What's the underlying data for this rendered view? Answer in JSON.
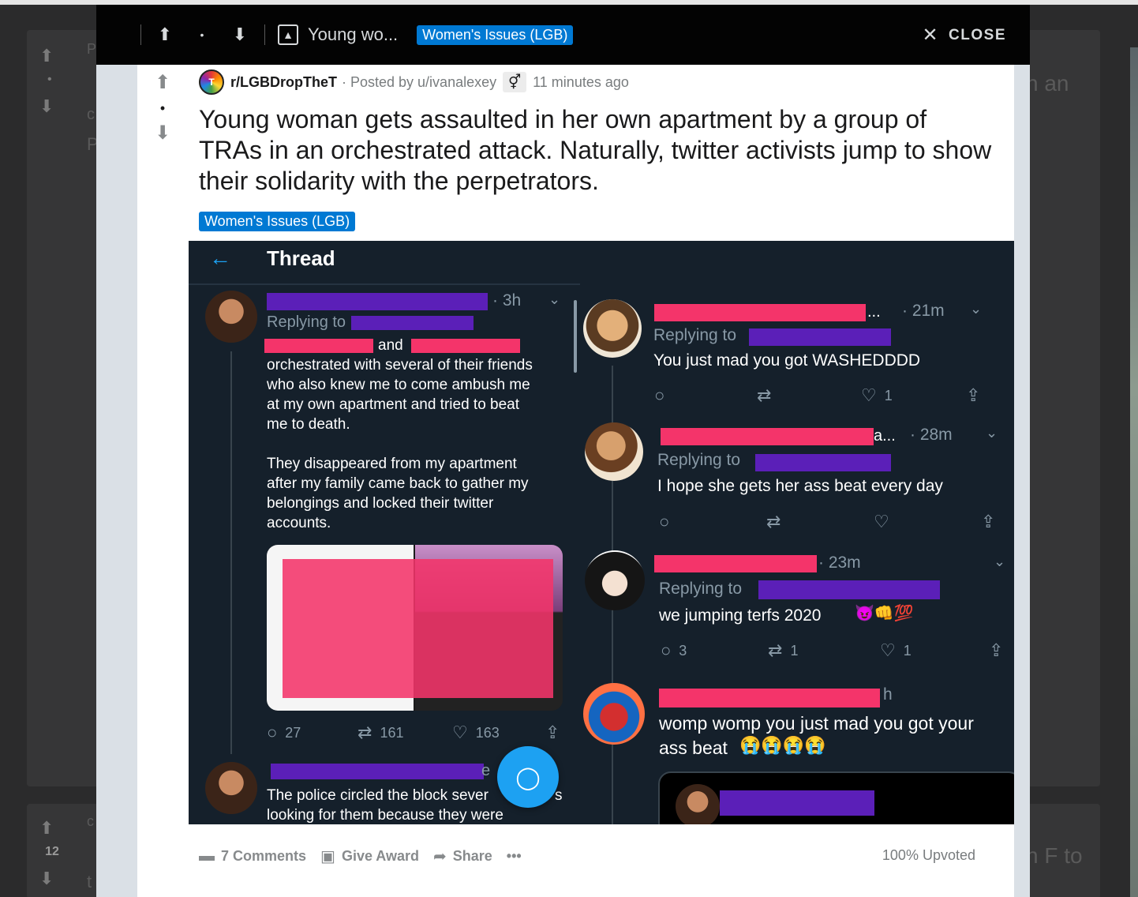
{
  "background": {
    "count": "12",
    "text_right_1": "n an",
    "text_right_2": "n F to",
    "left_letter_1": "P",
    "left_letter_2": "c",
    "left_letter_3": "P",
    "left_letter_4": "t"
  },
  "modal": {
    "title": "Young wo...",
    "flair": "Women's Issues (LGB)",
    "close_label": "CLOSE"
  },
  "post": {
    "subreddit": "r/LGBDropTheT",
    "posted_by": "· Posted by u/ivanalexey",
    "time_ago": "11 minutes ago",
    "title": "Young woman gets assaulted in her own apartment by a group of TRAs in an orchestrated attack. Naturally, twitter activists jump to show their solidarity with the perpetrators.",
    "flair": "Women's Issues (LGB)",
    "footer": {
      "comments": "7 Comments",
      "award": "Give Award",
      "share": "Share",
      "more": "•••",
      "upvoted": "100% Upvoted"
    }
  },
  "thread": {
    "header": "Thread",
    "main_tweet": {
      "time": "· 3h",
      "replying": "Replying to",
      "and": "and",
      "body": "orchestrated with several of their friends\nwho also knew me to come ambush me\nat my own apartment and tried to beat\nme to death.\n\nThey disappeared from my apartment\nafter my family came back to gather my\nbelongings and locked their twitter\naccounts.",
      "replies": "27",
      "retweets": "161",
      "likes": "163"
    },
    "second_tweet": {
      "partial_char": "e",
      "body_1": "The police circled the block sever",
      "body_1_tail": "s",
      "body_2": "looking for them because they were"
    },
    "replies": [
      {
        "ellipsis": "...",
        "time": "· 21m",
        "replying": "Replying to",
        "text": "You just mad you got WASHEDDDD",
        "retweets": "",
        "likes": "1"
      },
      {
        "ellipsis": "a...",
        "time": "· 28m",
        "replying": "Replying to",
        "text": "I hope she gets her ass beat every day",
        "retweets": "",
        "likes": ""
      },
      {
        "time": "· 23m",
        "replying": "Replying to",
        "text": "we jumping terfs 2020",
        "emoji": "😈👊💯",
        "replies": "3",
        "retweets": "1",
        "likes": "1"
      },
      {
        "time": "h",
        "text": "womp womp you just mad you got your\nass beat",
        "emoji": "😭😭😭😭"
      }
    ]
  },
  "colors": {
    "redact_red": "#f4346a",
    "redact_purple": "#5b1fb8",
    "reddit_blue": "#0079d3",
    "twitter_bg": "#15202b",
    "twitter_blue": "#1da1f2"
  },
  "icons": {
    "upvote": "arrow-up-icon",
    "downvote": "arrow-down-icon",
    "image": "image-icon",
    "close": "close-icon",
    "comment": "comment-icon",
    "gift": "gift-icon",
    "share": "share-icon",
    "retweet": "retweet-icon",
    "like": "heart-icon"
  }
}
